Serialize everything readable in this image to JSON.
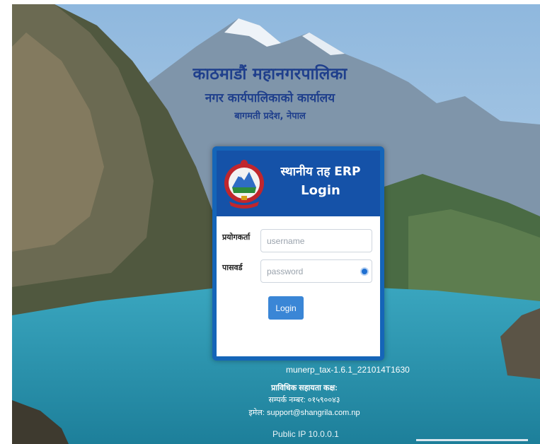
{
  "header": {
    "title_line1": "काठमाडौं महानगरपालिका",
    "title_line2": "नगर कार्यपालिकाको कार्यालय",
    "title_line3": "बागमती प्रदेश, नेपाल"
  },
  "login_card": {
    "title_line1": "स्थानीय तह ERP",
    "title_line2": "Login",
    "username_label": "प्रयोगकर्ता",
    "username_placeholder": "username",
    "username_value": "",
    "password_label": "पासवर्ड",
    "password_placeholder": "password",
    "password_value": "",
    "login_button": "Login"
  },
  "footer": {
    "version": "munerp_tax-1.6.1_221014T1630",
    "support_heading": "प्राविधिक सहायता कक्ष:",
    "support_phone": "सम्पर्क नम्बर: ०१५९००४३",
    "support_email": "इमेल: support@shangrila.com.np",
    "public_ip": "Public IP 10.0.0.1"
  },
  "colors": {
    "title": "#1f3f8c",
    "card_border": "#1565b8",
    "card_header": "#1552a8",
    "button": "#3a86d6"
  },
  "icons": [
    "nepal-emblem-icon",
    "eye-icon"
  ]
}
